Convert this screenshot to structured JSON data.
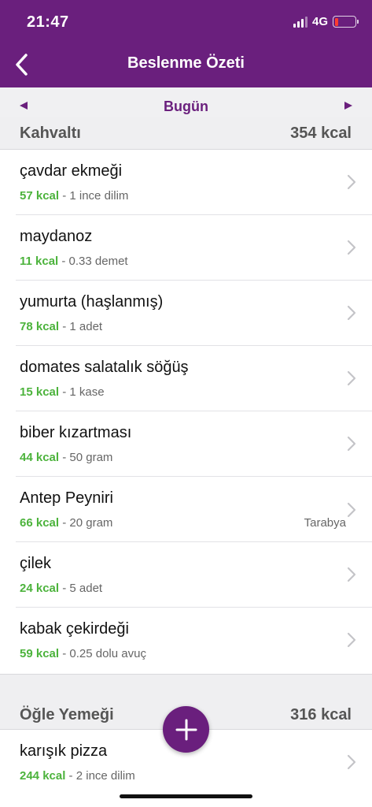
{
  "status": {
    "time": "21:47",
    "network": "4G"
  },
  "nav": {
    "title": "Beslenme Özeti",
    "back_icon": "chevron-left-icon"
  },
  "date_bar": {
    "label": "Bugün",
    "prev_icon": "triangle-left-icon",
    "next_icon": "triangle-right-icon"
  },
  "colors": {
    "brand": "#6a1f7d",
    "kcal_green": "#4cb33c",
    "battery_low": "#ff3b30"
  },
  "sections": [
    {
      "name": "Kahvaltı",
      "kcal": "354 kcal",
      "items": [
        {
          "name": "çavdar ekmeği",
          "kcal": "57 kcal",
          "amount": " - 1 ince dilim",
          "brand": ""
        },
        {
          "name": "maydanoz",
          "kcal": "11 kcal",
          "amount": " - 0.33 demet",
          "brand": ""
        },
        {
          "name": "yumurta (haşlanmış)",
          "kcal": "78 kcal",
          "amount": " - 1 adet",
          "brand": ""
        },
        {
          "name": "domates salatalık söğüş",
          "kcal": "15 kcal",
          "amount": " - 1 kase",
          "brand": ""
        },
        {
          "name": "biber kızartması",
          "kcal": "44 kcal",
          "amount": " - 50 gram",
          "brand": ""
        },
        {
          "name": "Antep Peyniri",
          "kcal": "66 kcal",
          "amount": " - 20 gram",
          "brand": "Tarabya"
        },
        {
          "name": "çilek",
          "kcal": "24 kcal",
          "amount": " - 5 adet",
          "brand": ""
        },
        {
          "name": "kabak çekirdeği",
          "kcal": "59 kcal",
          "amount": " - 0.25 dolu avuç",
          "brand": ""
        }
      ]
    },
    {
      "name": "Öğle Yemeği",
      "kcal": "316 kcal",
      "items": [
        {
          "name": "karışık pizza",
          "kcal": "244 kcal",
          "amount": " - 2 ince dilim",
          "brand": ""
        }
      ]
    }
  ],
  "fab": {
    "icon": "plus-icon"
  }
}
